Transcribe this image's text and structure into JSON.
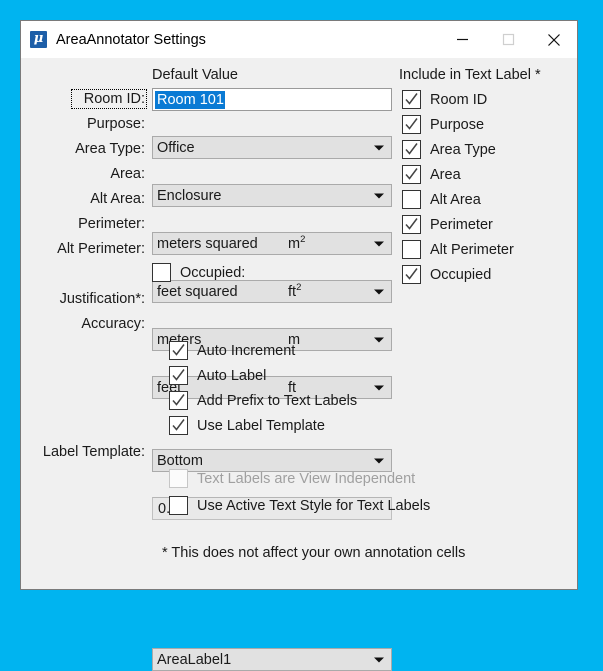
{
  "window": {
    "title": "AreaAnnotator Settings",
    "icon": "mu-app-icon",
    "icon_glyph": "μ",
    "accent_desktop_color": "#00b4f0",
    "titlebar_color": "#ffffff",
    "body_color": "#f0f0f0",
    "selection_color": "#0a7ad4",
    "controls": [
      {
        "name": "minimize-button",
        "glyph": "minimize"
      },
      {
        "name": "maximize-button",
        "glyph": "maximize",
        "disabled": true
      },
      {
        "name": "close-button",
        "glyph": "close"
      }
    ]
  },
  "headers": {
    "default_value": "Default Value",
    "include_in_text_label": "Include in Text Label *"
  },
  "form_rows": [
    {
      "label": "Room ID:",
      "label_focused": true,
      "control": "textbox",
      "value": "Room 101",
      "value_selected": true,
      "unit": ""
    },
    {
      "label": "Purpose:",
      "control": "combo",
      "value": "Office",
      "unit": ""
    },
    {
      "label": "Area Type:",
      "control": "combo",
      "value": "Enclosure",
      "unit": ""
    },
    {
      "label": "Area:",
      "control": "combo",
      "value": "meters squared",
      "unit": "m",
      "unit_sup": "2"
    },
    {
      "label": "Alt Area:",
      "control": "combo",
      "value": "feet squared",
      "unit": "ft",
      "unit_sup": "2"
    },
    {
      "label": "Perimeter:",
      "control": "combo",
      "value": "meters",
      "unit": "m"
    },
    {
      "label": "Alt Perimeter:",
      "control": "combo",
      "value": "feet",
      "unit": "ft"
    }
  ],
  "occupied_row": {
    "label": "Occupied:",
    "checked": false
  },
  "justification_row": {
    "label": "Justification*:",
    "control": "combo",
    "value": "Bottom"
  },
  "accuracy_row": {
    "label": "Accuracy:",
    "control": "flatbox",
    "value": "0.12"
  },
  "option_checkboxes": [
    {
      "label": "Auto Increment",
      "checked": true,
      "disabled": false
    },
    {
      "label": "Auto Label",
      "checked": true,
      "disabled": false
    },
    {
      "label": "Add Prefix to Text Labels",
      "checked": true,
      "disabled": false
    },
    {
      "label": "Use Label Template",
      "checked": true,
      "disabled": false
    }
  ],
  "label_template_row": {
    "label": "Label Template:",
    "control": "combo",
    "value": "AreaLabel1"
  },
  "lower_checkboxes": [
    {
      "label": "Text Labels are View Independent",
      "checked": false,
      "disabled": true
    },
    {
      "label": "Use Active Text Style for Text Labels",
      "checked": false,
      "disabled": false
    }
  ],
  "include_checkboxes": [
    {
      "label": "Room ID",
      "checked": true
    },
    {
      "label": "Purpose",
      "checked": true
    },
    {
      "label": "Area Type",
      "checked": true
    },
    {
      "label": "Area",
      "checked": true
    },
    {
      "label": "Alt Area",
      "checked": false
    },
    {
      "label": "Perimeter",
      "checked": true
    },
    {
      "label": "Alt Perimeter",
      "checked": false
    },
    {
      "label": "Occupied",
      "checked": true
    }
  ],
  "footnote": "* This does not affect your own annotation cells"
}
